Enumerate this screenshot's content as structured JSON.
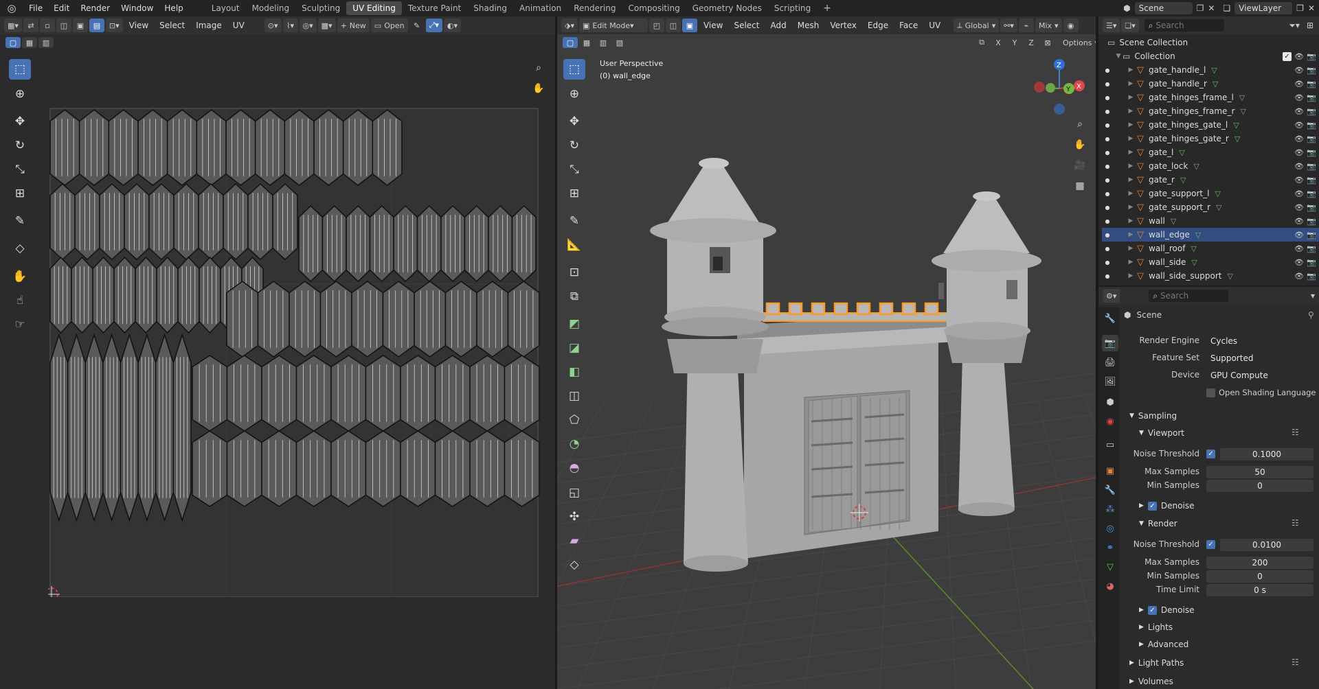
{
  "topbar": {
    "menus": [
      "File",
      "Edit",
      "Render",
      "Window",
      "Help"
    ],
    "workspaces": [
      "Layout",
      "Modeling",
      "Sculpting",
      "UV Editing",
      "Texture Paint",
      "Shading",
      "Animation",
      "Rendering",
      "Compositing",
      "Geometry Nodes",
      "Scripting"
    ],
    "add_tab": "+",
    "scene": "Scene",
    "view_layer": "ViewLayer"
  },
  "uv_header": {
    "menus": [
      "View",
      "Select",
      "Image",
      "UV"
    ],
    "new_label": "New",
    "open_label": "Open"
  },
  "viewport_header": {
    "mode": "Edit Mode",
    "menus": [
      "View",
      "Select",
      "Add",
      "Mesh",
      "Vertex",
      "Edge",
      "Face",
      "UV"
    ],
    "orientation": "Global",
    "shading": "Mix",
    "options": "Options",
    "axes": [
      "X",
      "Y",
      "Z"
    ]
  },
  "viewport": {
    "view_name": "User Perspective",
    "object_info": "(0) wall_edge",
    "gizmo_x": "X",
    "gizmo_y": "Y",
    "gizmo_z": "Z"
  },
  "outliner": {
    "search_placeholder": "Search",
    "root": "Scene Collection",
    "collection": "Collection",
    "items": [
      "gate_handle_l",
      "gate_handle_r",
      "gate_hinges_frame_l",
      "gate_hinges_frame_r",
      "gate_hinges_gate_l",
      "gate_hinges_gate_r",
      "gate_l",
      "gate_lock",
      "gate_r",
      "gate_support_l",
      "gate_support_r",
      "wall",
      "wall_edge",
      "wall_roof",
      "wall_side",
      "wall_side_support"
    ],
    "selected": "wall_edge"
  },
  "properties": {
    "search_placeholder": "Search",
    "context": "Scene",
    "render_engine_label": "Render Engine",
    "render_engine": "Cycles",
    "feature_set_label": "Feature Set",
    "feature_set": "Supported",
    "device_label": "Device",
    "device": "GPU Compute",
    "osl_label": "Open Shading Language",
    "sampling": "Sampling",
    "viewport": "Viewport",
    "vp_noise_label": "Noise Threshold",
    "vp_noise": "0.1000",
    "vp_max_label": "Max Samples",
    "vp_max": "50",
    "vp_min_label": "Min Samples",
    "vp_min": "0",
    "denoise": "Denoise",
    "render": "Render",
    "r_noise_label": "Noise Threshold",
    "r_noise": "0.0100",
    "r_max_label": "Max Samples",
    "r_max": "200",
    "r_min_label": "Min Samples",
    "r_min": "0",
    "time_limit_label": "Time Limit",
    "time_limit": "0 s",
    "denoise2": "Denoise",
    "lights": "Lights",
    "advanced": "Advanced",
    "light_paths": "Light Paths",
    "volumes": "Volumes"
  },
  "colors": {
    "accent": "#4772b3",
    "selected_row": "#334d80",
    "edge_highlight": "#ff9a22",
    "mesh_icon": "#e0843a"
  }
}
